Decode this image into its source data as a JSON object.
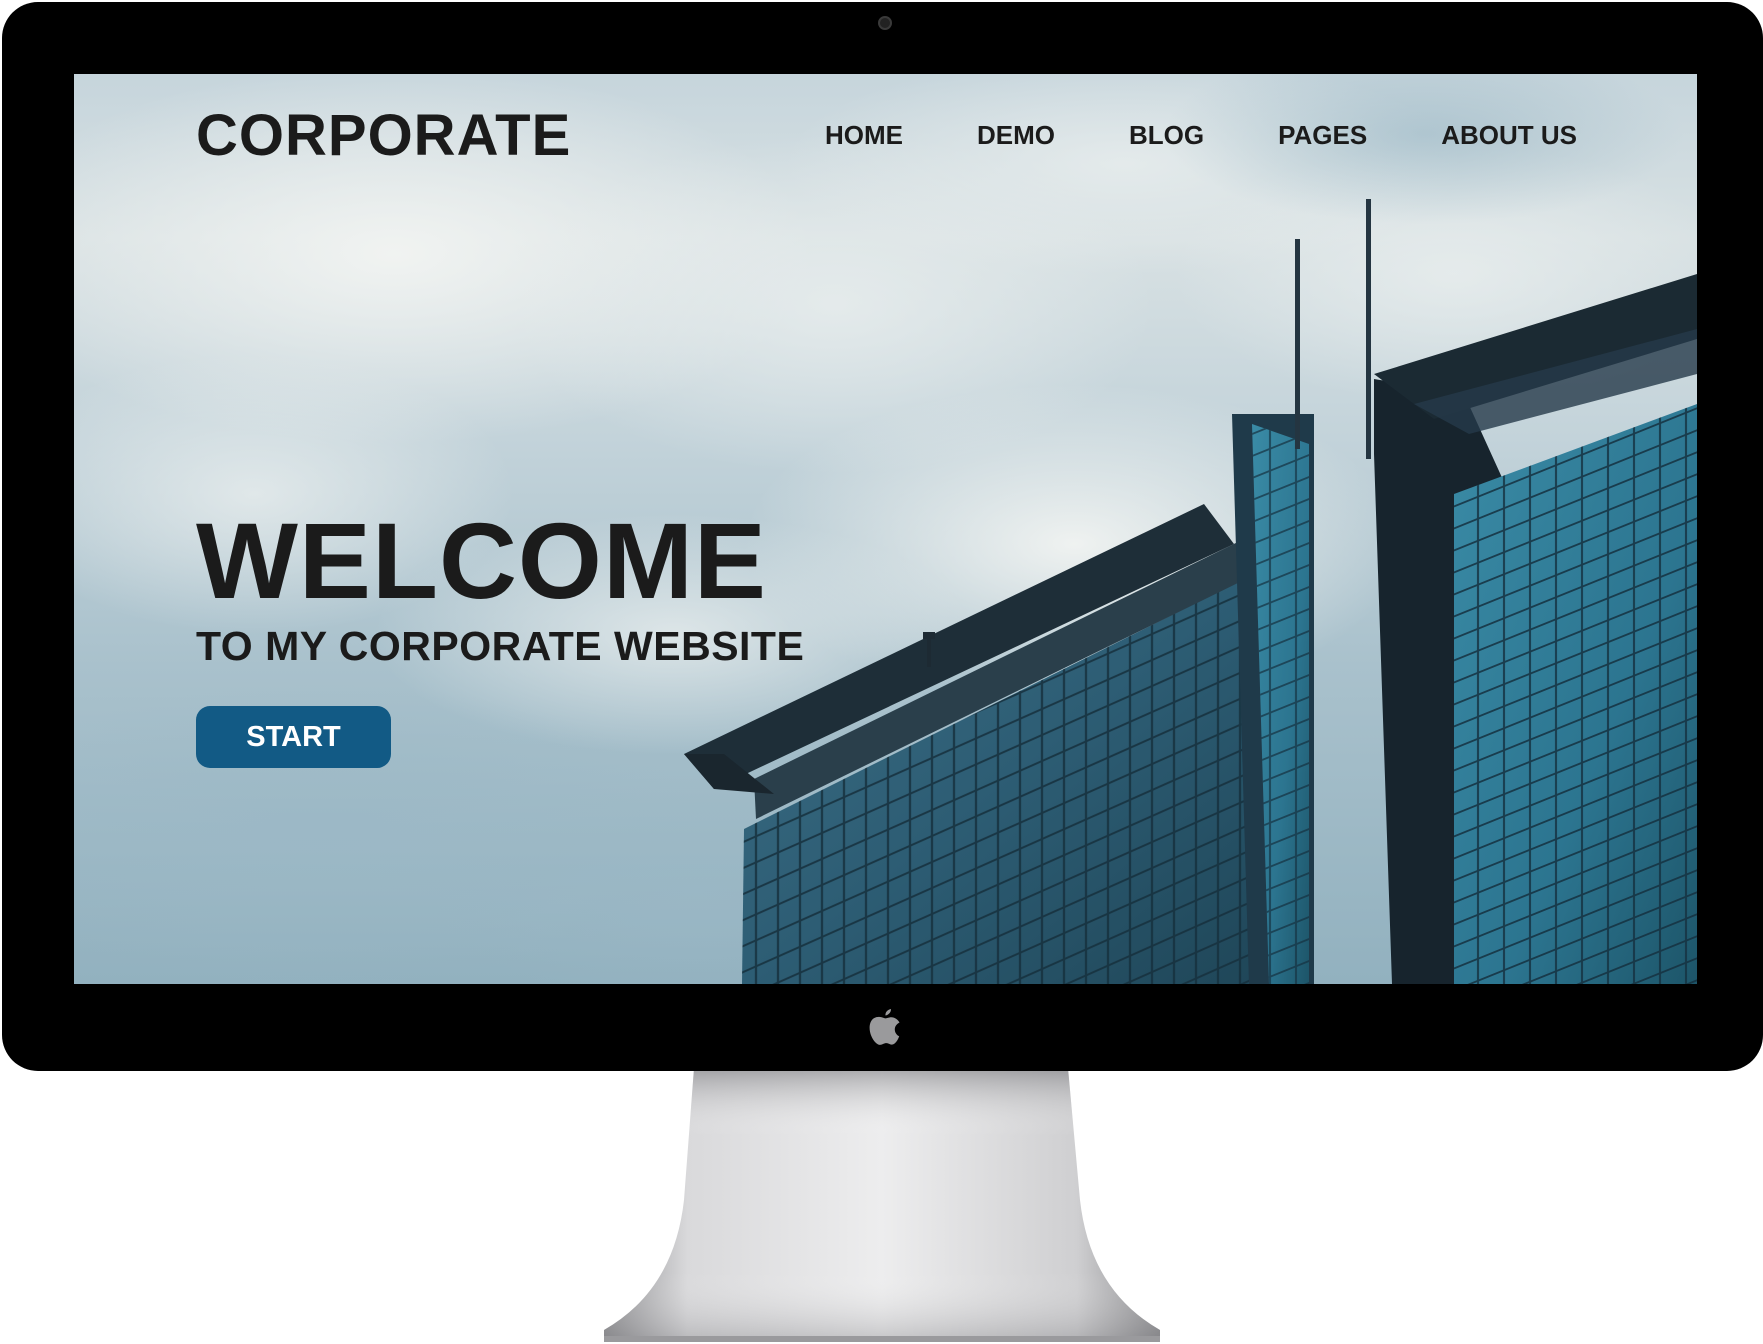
{
  "site": {
    "brand": "CORPORATE",
    "nav": [
      {
        "label": "HOME"
      },
      {
        "label": "DEMO"
      },
      {
        "label": "BLOG"
      },
      {
        "label": "PAGES"
      },
      {
        "label": "ABOUT US"
      }
    ]
  },
  "hero": {
    "title": "WELCOME",
    "subtitle": "TO MY CORPORATE WEBSITE",
    "button_label": "START"
  },
  "colors": {
    "text": "#1b1b1b",
    "button": "#125a85",
    "bezel": "#000000",
    "stand": "#c4c4c6"
  },
  "icons": {
    "camera": "camera-icon",
    "logo": "apple-logo-icon"
  }
}
